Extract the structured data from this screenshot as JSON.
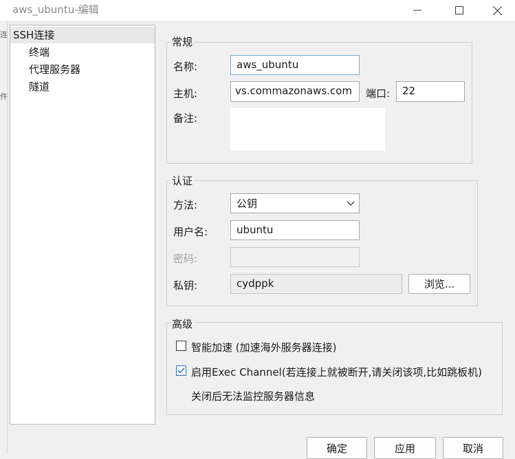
{
  "window": {
    "title": "aws_ubuntu-编辑",
    "minimize_icon": "minimize-icon",
    "maximize_icon": "maximize-icon",
    "close_icon": "close-icon"
  },
  "background_fragments": [
    "连",
    "件"
  ],
  "tree": {
    "items": [
      {
        "label": "SSH连接",
        "selected": true
      },
      {
        "label": "终端"
      },
      {
        "label": "代理服务器"
      },
      {
        "label": "隧道"
      }
    ]
  },
  "general": {
    "title": "常规",
    "name_label": "名称:",
    "name_value": "aws_ubuntu",
    "host_label": "主机:",
    "host_value": "vs.commazonaws.com",
    "port_label": "端口:",
    "port_value": "22",
    "note_label": "备注:",
    "note_value": ""
  },
  "auth": {
    "title": "认证",
    "method_label": "方法:",
    "method_value": "公钥",
    "username_label": "用户名:",
    "username_value": "ubuntu",
    "password_label": "密码:",
    "password_value": "",
    "key_label": "私钥:",
    "key_value": "cydppk",
    "browse_label": "浏览..."
  },
  "advanced": {
    "title": "高级",
    "smart_accel_label": "智能加速 (加速海外服务器连接)",
    "smart_accel_checked": false,
    "exec_channel_label": "启用Exec Channel(若连接上就被断开,请关闭该项,比如跳板机)",
    "exec_channel_checked": true,
    "exec_channel_note": "关闭后无法监控服务器信息"
  },
  "buttons": {
    "ok": "确定",
    "apply": "应用",
    "cancel": "取消"
  },
  "colors": {
    "window_bg": "#f0f0f0",
    "focus_border": "#7aa7e0",
    "check_accent": "#2c6fd1"
  }
}
